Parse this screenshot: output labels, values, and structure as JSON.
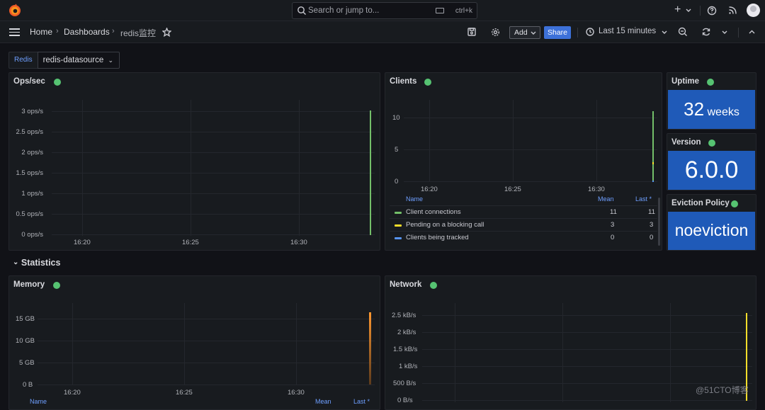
{
  "topbar": {
    "search_placeholder": "Search or jump to...",
    "search_shortcut": "ctrl+k",
    "plus_label": "+",
    "icons": [
      "grafana-logo-icon",
      "search-icon",
      "keyboard-icon",
      "plus-icon",
      "chevron-down-icon",
      "help-icon",
      "rss-icon",
      "avatar"
    ]
  },
  "breadcrumb": {
    "home": "Home",
    "dashboards": "Dashboards",
    "current": "redis监控"
  },
  "toolbar": {
    "add_label": "Add",
    "share_label": "Share",
    "time_range": "Last 15 minutes"
  },
  "variables": {
    "label": "Redis",
    "value": "redis-datasource"
  },
  "panels": {
    "ops": {
      "title": "Ops/sec",
      "y_ticks": [
        "3 ops/s",
        "2.5 ops/s",
        "2 ops/s",
        "1.5 ops/s",
        "1 ops/s",
        "0.5 ops/s",
        "0 ops/s"
      ],
      "x_ticks": [
        "16:20",
        "16:25",
        "16:30"
      ]
    },
    "clients": {
      "title": "Clients",
      "y_ticks": [
        "10",
        "5",
        "0"
      ],
      "x_ticks": [
        "16:20",
        "16:25",
        "16:30"
      ],
      "legend_headers": {
        "name": "Name",
        "mean": "Mean",
        "last": "Last *"
      },
      "legend": [
        {
          "name": "Client connections",
          "mean": "11",
          "last": "11",
          "color": "#73bf69"
        },
        {
          "name": "Pending on a blocking call",
          "mean": "3",
          "last": "3",
          "color": "#fade2a"
        },
        {
          "name": "Clients being tracked",
          "mean": "0",
          "last": "0",
          "color": "#5794f2"
        }
      ]
    },
    "uptime": {
      "title": "Uptime",
      "value": "32",
      "unit": "weeks"
    },
    "version": {
      "title": "Version",
      "value": "6.0.0"
    },
    "eviction": {
      "title": "Eviction Policy",
      "value": "noeviction"
    },
    "memory": {
      "title": "Memory",
      "y_ticks": [
        "15 GB",
        "10 GB",
        "5 GB",
        "0 B"
      ],
      "x_ticks": [
        "16:20",
        "16:25",
        "16:30"
      ],
      "legend_headers": {
        "name": "Name",
        "mean": "Mean",
        "last": "Last *"
      }
    },
    "network": {
      "title": "Network",
      "y_ticks": [
        "2.5 kB/s",
        "2 kB/s",
        "1.5 kB/s",
        "1 kB/s",
        "500 B/s",
        "0 B/s"
      ]
    }
  },
  "section_statistics": "Statistics",
  "colors": {
    "status_ok": "#56c372",
    "stat_bg": "#1f5ab8",
    "share_bg": "#3d71d9",
    "series_green": "#73bf69",
    "series_yellow": "#fade2a",
    "series_blue": "#5794f2",
    "series_orange": "#ff9830"
  },
  "watermark": "@51CTO博客"
}
